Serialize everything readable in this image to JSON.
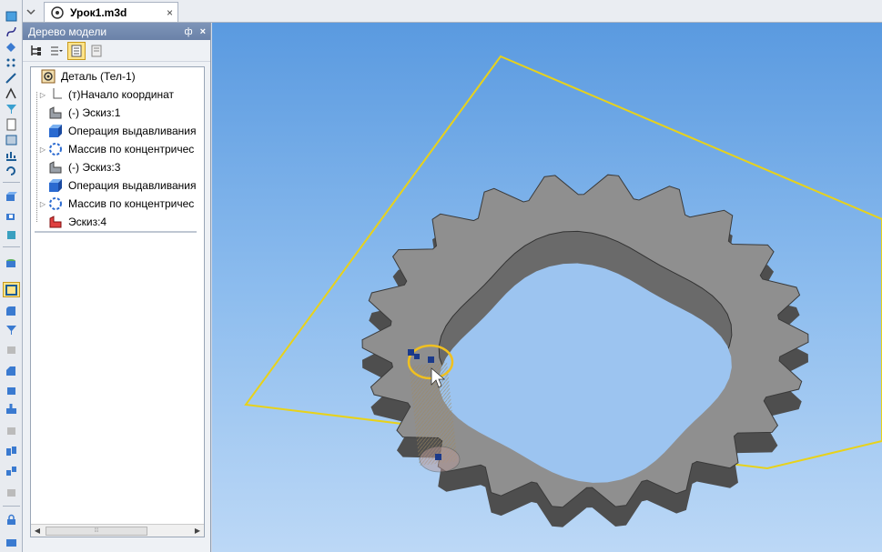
{
  "document_tab": {
    "title": "Урок1.m3d",
    "close": "×"
  },
  "panel": {
    "title": "Дерево модели",
    "pin": "ф",
    "close": "×"
  },
  "tree": {
    "items": [
      {
        "label": "Деталь (Тел-1)",
        "icon": "part-icon",
        "expander": ""
      },
      {
        "label": "(т)Начало координат",
        "icon": "origin-icon",
        "expander": "▷"
      },
      {
        "label": "(-) Эскиз:1",
        "icon": "sketch-icon",
        "expander": ""
      },
      {
        "label": "Операция выдавливания",
        "icon": "extrude-icon",
        "expander": ""
      },
      {
        "label": "Массив по концентричес",
        "icon": "circular-array-icon",
        "expander": "▷"
      },
      {
        "label": "(-) Эскиз:3",
        "icon": "sketch-icon",
        "expander": ""
      },
      {
        "label": "Операция выдавливания",
        "icon": "extrude-icon",
        "expander": ""
      },
      {
        "label": "Массив по концентричес",
        "icon": "circular-array-icon",
        "expander": "▷"
      },
      {
        "label": "Эскиз:4",
        "icon": "sketch-active-icon",
        "expander": ""
      }
    ]
  },
  "scrollbar": {
    "left": "◀",
    "right": "▶",
    "grip": "⁞⁞⁞"
  },
  "colors": {
    "viewport_top": "#5a9ae0",
    "viewport_bottom": "#bcd8f6",
    "gear_face": "#8f8f8f",
    "plane": "#e8d21a",
    "sketch_circle": "#f0c020",
    "panel_header": "#6b82a8"
  }
}
